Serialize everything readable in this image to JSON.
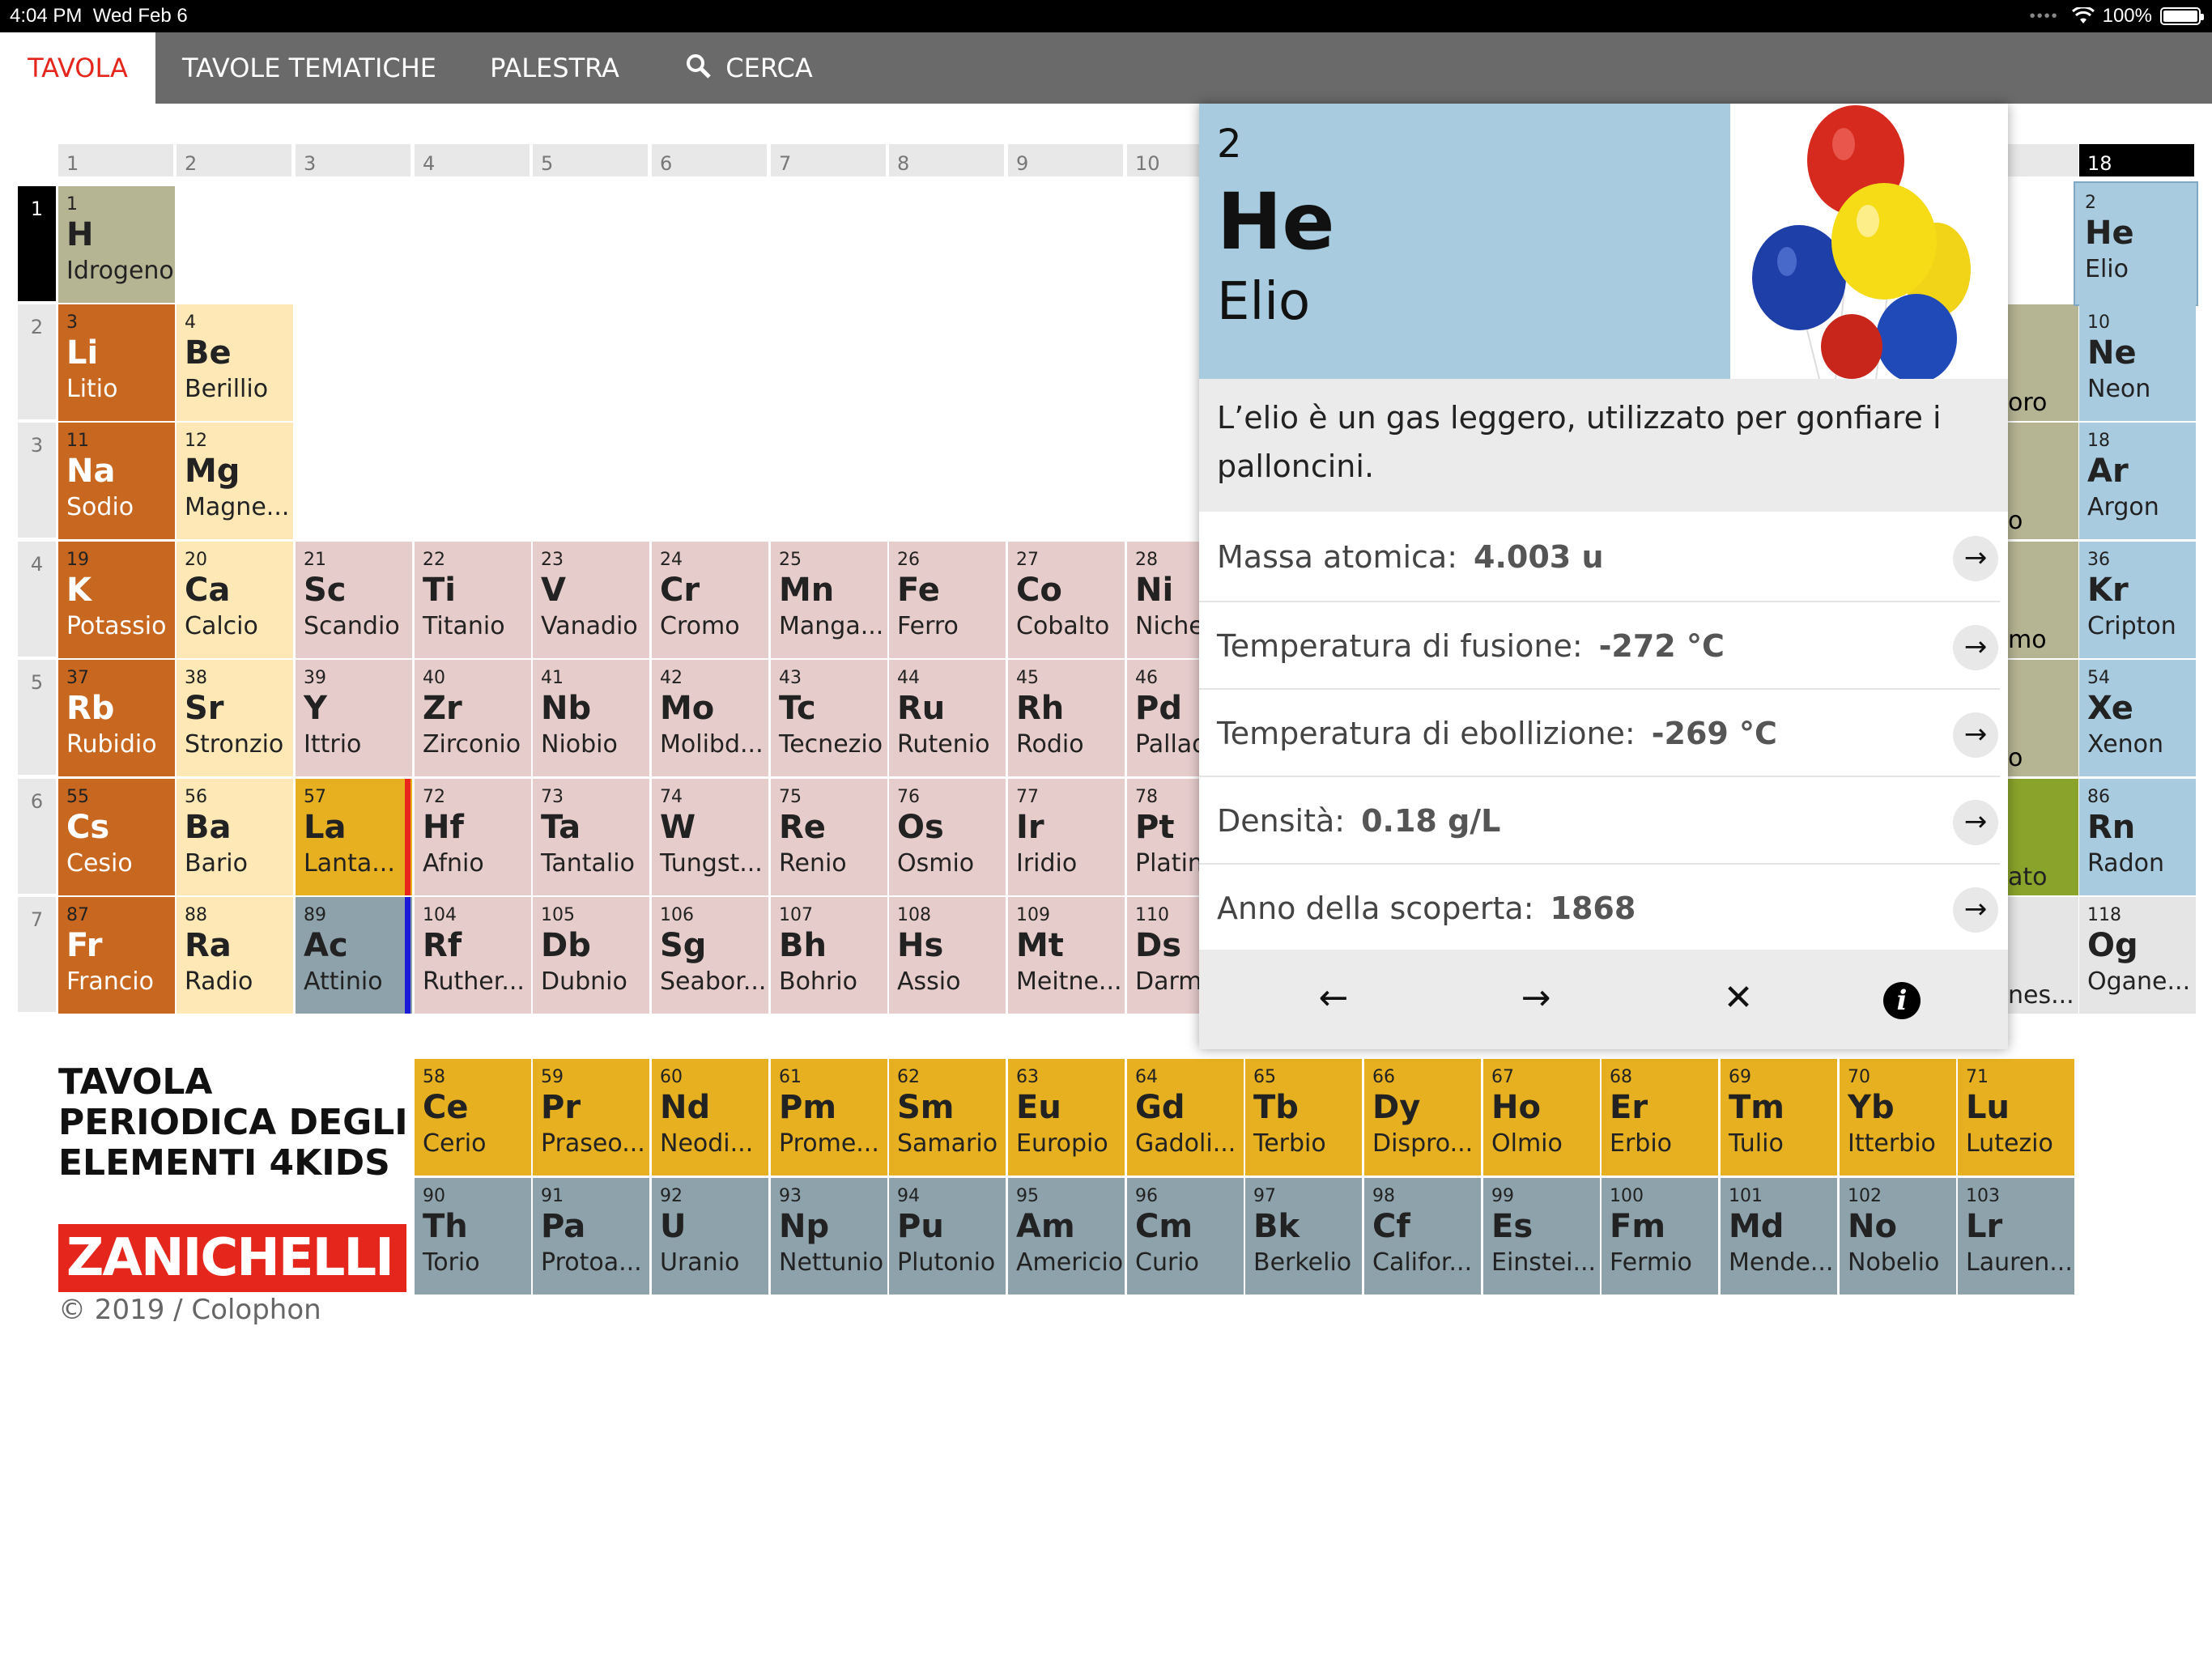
{
  "status_bar": {
    "time": "4:04 PM",
    "date": "Wed Feb 6",
    "battery": "100%"
  },
  "nav": {
    "tabs": [
      "TAVOLA",
      "TAVOLE TEMATICHE",
      "PALESTRA",
      "CERCA"
    ],
    "active": 0
  },
  "columns": [
    "1",
    "2",
    "3",
    "4",
    "5",
    "6",
    "7",
    "8",
    "9",
    "10",
    "18"
  ],
  "rows": [
    "1",
    "2",
    "3",
    "4",
    "5",
    "6",
    "7"
  ],
  "elements": [
    {
      "n": "1",
      "s": "H",
      "name": "Idrogeno"
    },
    {
      "n": "3",
      "s": "Li",
      "name": "Litio"
    },
    {
      "n": "4",
      "s": "Be",
      "name": "Berillio"
    },
    {
      "n": "11",
      "s": "Na",
      "name": "Sodio"
    },
    {
      "n": "12",
      "s": "Mg",
      "name": "Magne..."
    },
    {
      "n": "19",
      "s": "K",
      "name": "Potassio"
    },
    {
      "n": "20",
      "s": "Ca",
      "name": "Calcio"
    },
    {
      "n": "21",
      "s": "Sc",
      "name": "Scandio"
    },
    {
      "n": "22",
      "s": "Ti",
      "name": "Titanio"
    },
    {
      "n": "23",
      "s": "V",
      "name": "Vanadio"
    },
    {
      "n": "24",
      "s": "Cr",
      "name": "Cromo"
    },
    {
      "n": "25",
      "s": "Mn",
      "name": "Manga..."
    },
    {
      "n": "26",
      "s": "Fe",
      "name": "Ferro"
    },
    {
      "n": "27",
      "s": "Co",
      "name": "Cobalto"
    },
    {
      "n": "28",
      "s": "Ni",
      "name": "Nichel"
    },
    {
      "n": "37",
      "s": "Rb",
      "name": "Rubidio"
    },
    {
      "n": "38",
      "s": "Sr",
      "name": "Stronzio"
    },
    {
      "n": "39",
      "s": "Y",
      "name": "Ittrio"
    },
    {
      "n": "40",
      "s": "Zr",
      "name": "Zirconio"
    },
    {
      "n": "41",
      "s": "Nb",
      "name": "Niobio"
    },
    {
      "n": "42",
      "s": "Mo",
      "name": "Molibd..."
    },
    {
      "n": "43",
      "s": "Tc",
      "name": "Tecnezio"
    },
    {
      "n": "44",
      "s": "Ru",
      "name": "Rutenio"
    },
    {
      "n": "45",
      "s": "Rh",
      "name": "Rodio"
    },
    {
      "n": "46",
      "s": "Pd",
      "name": "Palladio"
    },
    {
      "n": "55",
      "s": "Cs",
      "name": "Cesio"
    },
    {
      "n": "56",
      "s": "Ba",
      "name": "Bario"
    },
    {
      "n": "57",
      "s": "La",
      "name": "Lanta..."
    },
    {
      "n": "72",
      "s": "Hf",
      "name": "Afnio"
    },
    {
      "n": "73",
      "s": "Ta",
      "name": "Tantalio"
    },
    {
      "n": "74",
      "s": "W",
      "name": "Tungst..."
    },
    {
      "n": "75",
      "s": "Re",
      "name": "Renio"
    },
    {
      "n": "76",
      "s": "Os",
      "name": "Osmio"
    },
    {
      "n": "77",
      "s": "Ir",
      "name": "Iridio"
    },
    {
      "n": "78",
      "s": "Pt",
      "name": "Platino"
    },
    {
      "n": "87",
      "s": "Fr",
      "name": "Francio"
    },
    {
      "n": "88",
      "s": "Ra",
      "name": "Radio"
    },
    {
      "n": "89",
      "s": "Ac",
      "name": "Attinio"
    },
    {
      "n": "104",
      "s": "Rf",
      "name": "Ruther..."
    },
    {
      "n": "105",
      "s": "Db",
      "name": "Dubnio"
    },
    {
      "n": "106",
      "s": "Sg",
      "name": "Seabor..."
    },
    {
      "n": "107",
      "s": "Bh",
      "name": "Bohrio"
    },
    {
      "n": "108",
      "s": "Hs",
      "name": "Assio"
    },
    {
      "n": "109",
      "s": "Mt",
      "name": "Meitne..."
    },
    {
      "n": "110",
      "s": "Ds",
      "name": "Darms..."
    },
    {
      "n": "2",
      "s": "He",
      "name": "Elio"
    },
    {
      "n": "10",
      "s": "Ne",
      "name": "Neon"
    },
    {
      "n": "18",
      "s": "Ar",
      "name": "Argon"
    },
    {
      "n": "36",
      "s": "Kr",
      "name": "Cripton"
    },
    {
      "n": "54",
      "s": "Xe",
      "name": "Xenon"
    },
    {
      "n": "86",
      "s": "Rn",
      "name": "Radon"
    },
    {
      "n": "118",
      "s": "Og",
      "name": "Ogane..."
    },
    {
      "n": "58",
      "s": "Ce",
      "name": "Cerio"
    },
    {
      "n": "59",
      "s": "Pr",
      "name": "Praseo..."
    },
    {
      "n": "60",
      "s": "Nd",
      "name": "Neodi..."
    },
    {
      "n": "61",
      "s": "Pm",
      "name": "Prome..."
    },
    {
      "n": "62",
      "s": "Sm",
      "name": "Samario"
    },
    {
      "n": "63",
      "s": "Eu",
      "name": "Europio"
    },
    {
      "n": "64",
      "s": "Gd",
      "name": "Gadoli..."
    },
    {
      "n": "65",
      "s": "Tb",
      "name": "Terbio"
    },
    {
      "n": "66",
      "s": "Dy",
      "name": "Dispro..."
    },
    {
      "n": "67",
      "s": "Ho",
      "name": "Olmio"
    },
    {
      "n": "68",
      "s": "Er",
      "name": "Erbio"
    },
    {
      "n": "69",
      "s": "Tm",
      "name": "Tulio"
    },
    {
      "n": "70",
      "s": "Yb",
      "name": "Itterbio"
    },
    {
      "n": "71",
      "s": "Lu",
      "name": "Lutezio"
    },
    {
      "n": "90",
      "s": "Th",
      "name": "Torio"
    },
    {
      "n": "91",
      "s": "Pa",
      "name": "Protoa..."
    },
    {
      "n": "92",
      "s": "U",
      "name": "Uranio"
    },
    {
      "n": "93",
      "s": "Np",
      "name": "Nettunio"
    },
    {
      "n": "94",
      "s": "Pu",
      "name": "Plutonio"
    },
    {
      "n": "95",
      "s": "Am",
      "name": "Americio"
    },
    {
      "n": "96",
      "s": "Cm",
      "name": "Curio"
    },
    {
      "n": "97",
      "s": "Bk",
      "name": "Berkelio"
    },
    {
      "n": "98",
      "s": "Cf",
      "name": "Califor..."
    },
    {
      "n": "99",
      "s": "Es",
      "name": "Einstei..."
    },
    {
      "n": "100",
      "s": "Fm",
      "name": "Fermio"
    },
    {
      "n": "101",
      "s": "Md",
      "name": "Mende..."
    },
    {
      "n": "102",
      "s": "No",
      "name": "Nobelio"
    },
    {
      "n": "103",
      "s": "Lr",
      "name": "Lauren..."
    }
  ],
  "partial_labels": [
    "oro",
    "o",
    "mo",
    "o",
    "ato",
    "nes..."
  ],
  "detail": {
    "number": "2",
    "symbol": "He",
    "name": "Elio",
    "description": "L’elio è un gas leggero, utilizzato per gonfiare i palloncini.",
    "properties": [
      {
        "label": "Massa atomica:",
        "value": "4.003 u"
      },
      {
        "label": "Temperatura di fusione:",
        "value": "-272 °C"
      },
      {
        "label": "Temperatura di ebollizione:",
        "value": "-269 °C"
      },
      {
        "label": "Densità:",
        "value": "0.18 g/L"
      },
      {
        "label": "Anno della scoperta:",
        "value": "1868"
      }
    ]
  },
  "title": {
    "line1": "TAVOLA",
    "line2": "PERIODICA DEGLI",
    "line3": "ELEMENTI 4KIDS"
  },
  "brand": "ZANICHELLI",
  "copyright": "© 2019 / Colophon",
  "colors": {
    "accent": "#e4261c",
    "noble_gas": "#a8cbdf",
    "alkali": "#c8671f",
    "transition": "#e7cccc",
    "lanthanide": "#e6b020",
    "actinide": "#8ea2ac"
  }
}
